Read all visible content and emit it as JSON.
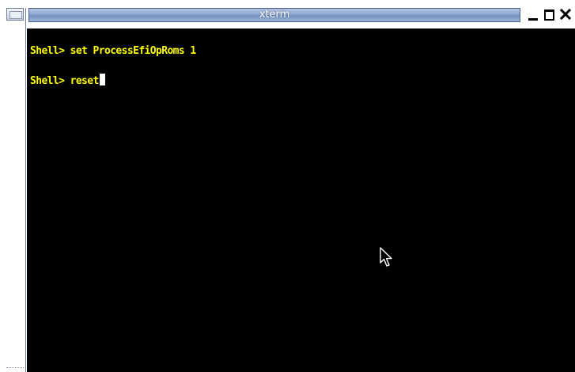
{
  "window": {
    "title": "xterm",
    "menu_icon": "window-menu-icon",
    "controls": {
      "minimize_icon": "minimize-icon",
      "maximize_icon": "maximize-icon",
      "close_icon": "close-icon"
    }
  },
  "terminal": {
    "lines": [
      {
        "prompt": "Shell>",
        "command": " set ProcessEfiOpRoms 1"
      },
      {
        "prompt": "Shell>",
        "command": " reset"
      }
    ],
    "text_color": "#ffff00",
    "background_color": "#000000",
    "cursor_color": "#ffffff",
    "pointer_icon": "mouse-pointer-icon"
  }
}
